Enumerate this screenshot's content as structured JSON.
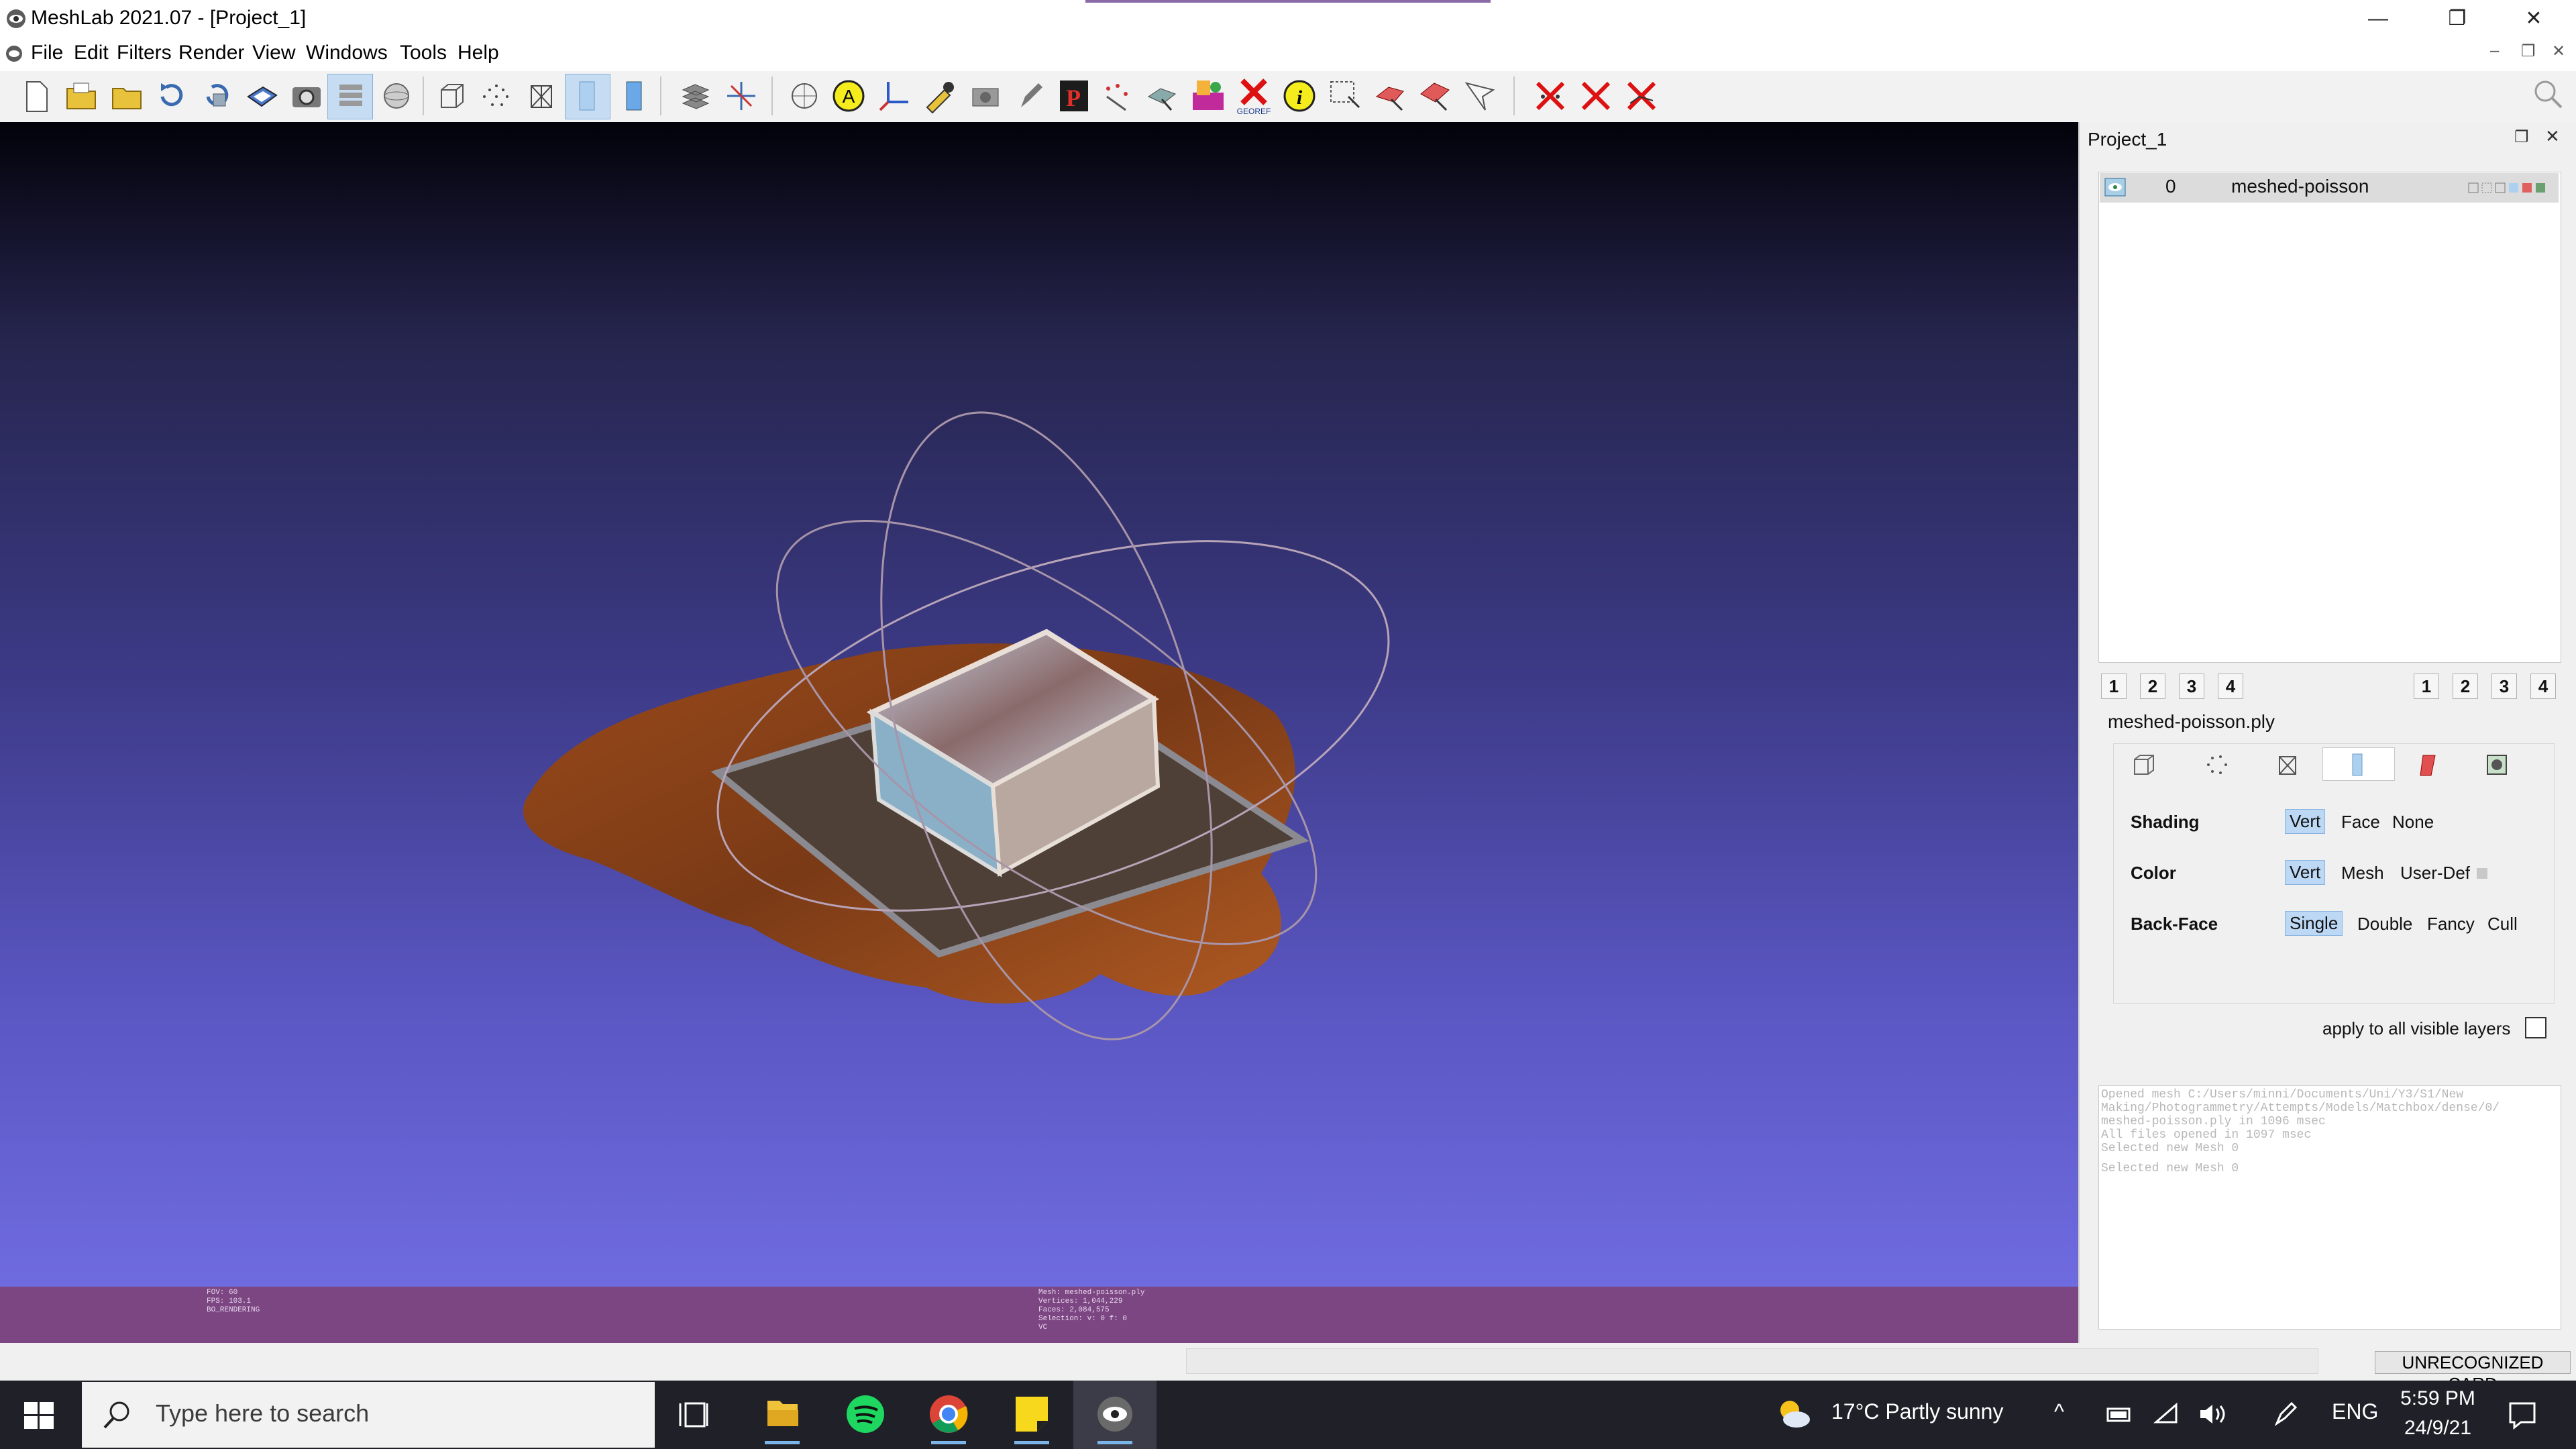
{
  "window": {
    "title": "MeshLab 2021.07 - [Project_1]",
    "minimize": "—",
    "restore": "❐",
    "close": "✕"
  },
  "menu": {
    "items": [
      "File",
      "Edit",
      "Filters",
      "Render",
      "View",
      "Windows",
      "Tools",
      "Help"
    ]
  },
  "toolbar": {
    "tools": [
      "new-project",
      "open-project",
      "open-mesh",
      "reload",
      "reload-all",
      "save",
      "snapshot",
      "layers",
      "draw-bbox-sphere",
      "bbox",
      "points",
      "wireframe",
      "flat",
      "smooth",
      "texture",
      "ruler",
      "axis-gizmo",
      "info-sphere",
      "annotate-a",
      "axes",
      "color-picker",
      "camera",
      "pen",
      "paint",
      "point-picking",
      "align",
      "georef",
      "info",
      "select-vertices",
      "select-faces",
      "select-connected",
      "select-region",
      "delete-vertices",
      "delete-faces",
      "delete-selection"
    ],
    "labels": {
      "georef": "GEOREF",
      "annotate_a": "A",
      "info": "i",
      "paint": "P"
    }
  },
  "viewport": {
    "info_left": [
      "FOV: 60",
      "FPS:   103.1",
      "BO_RENDERING"
    ],
    "info_center": [
      "Mesh: meshed-poisson.ply",
      "Vertices: 1,044,229",
      "Faces: 2,084,575",
      "Selection: v: 0 f: 0",
      "VC"
    ]
  },
  "project_panel": {
    "title": "Project_1",
    "layers": [
      {
        "index": "0",
        "name": "meshed-poisson"
      }
    ],
    "pages_left": [
      "1",
      "2",
      "3",
      "4"
    ],
    "pages_right": [
      "1",
      "2",
      "3",
      "4"
    ],
    "mesh_file": "meshed-poisson.ply",
    "render_tabs": [
      "box-icon",
      "points-icon",
      "wire-icon",
      "smooth-icon",
      "color-icon",
      "texture-icon"
    ],
    "shading": {
      "label": "Shading",
      "options": [
        "Vert",
        "Face",
        "None"
      ],
      "selected": "Vert"
    },
    "color": {
      "label": "Color",
      "options": [
        "Vert",
        "Mesh",
        "User-Def"
      ],
      "selected": "Vert"
    },
    "backface": {
      "label": "Back-Face",
      "options": [
        "Single",
        "Double",
        "Fancy",
        "Cull"
      ],
      "selected": "Single"
    },
    "apply_all": "apply to all visible layers"
  },
  "log": [
    "Opened mesh C:/Users/minni/Documents/Uni/Y3/S1/New",
    "Making/Photogrammetry/Attempts/Models/Matchbox/dense/0/",
    "meshed-poisson.ply in 1096 msec",
    "All files opened in 1097 msec",
    "Selected new Mesh 0",
    "",
    "Selected new Mesh 0"
  ],
  "status": {
    "card": "UNRECOGNIZED CARD"
  },
  "taskbar": {
    "search_placeholder": "Type here to search",
    "apps": [
      "task-view",
      "file-explorer",
      "spotify",
      "chrome",
      "sticky-notes",
      "meshlab"
    ],
    "weather": "17°C  Partly sunny",
    "language": "ENG",
    "time": "5:59 PM",
    "date": "24/9/21"
  },
  "colors": {
    "viewport_top": "#02020a",
    "viewport_bottom": "#7370e6",
    "footer": "#7c4683",
    "selected_option": "#bcd8f5"
  }
}
